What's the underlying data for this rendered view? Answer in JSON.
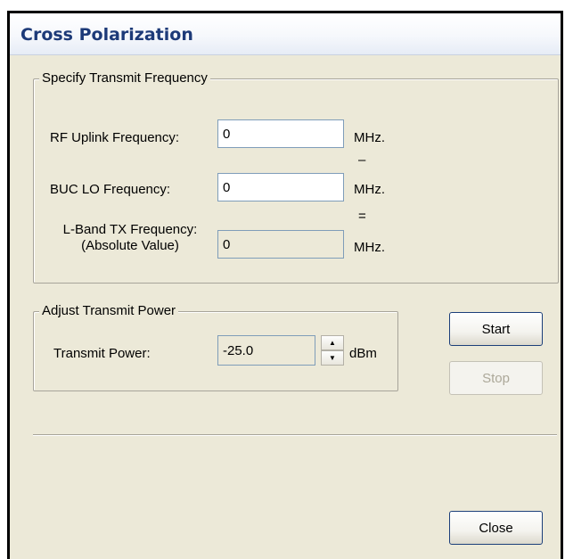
{
  "window": {
    "title": "Cross Polarization"
  },
  "frequency_group": {
    "legend": "Specify Transmit Frequency",
    "rf_uplink": {
      "label": "RF Uplink Frequency:",
      "value": "0",
      "unit": "MHz."
    },
    "minus_symbol": "–",
    "buc_lo": {
      "label": "BUC LO Frequency:",
      "value": "0",
      "unit": "MHz."
    },
    "equals_symbol": "=",
    "lband_tx": {
      "label_line1": "L-Band TX Frequency:",
      "label_line2": "(Absolute Value)",
      "value": "0",
      "unit": "MHz."
    }
  },
  "power_group": {
    "legend": "Adjust Transmit Power",
    "transmit_power": {
      "label": "Transmit Power:",
      "value": "-25.0",
      "unit": "dBm"
    }
  },
  "buttons": {
    "start": "Start",
    "stop": "Stop",
    "close": "Close"
  }
}
